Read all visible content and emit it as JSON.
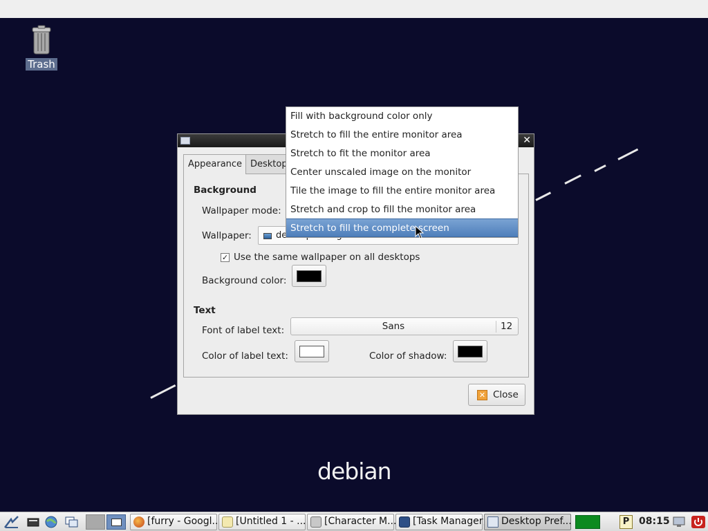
{
  "desktop": {
    "trash_label": "Trash",
    "logo_text": "debian",
    "background_color": "#0b0b2b"
  },
  "dialog": {
    "tabs": [
      {
        "label": "Appearance",
        "active": true
      },
      {
        "label": "Desktop",
        "active": false
      }
    ],
    "background": {
      "heading": "Background",
      "wallpaper_mode_label": "Wallpaper mode:",
      "wallpaper_label": "Wallpaper:",
      "wallpaper_value": "desktop-background",
      "same_wallpaper_label": "Use the same wallpaper on all desktops",
      "same_wallpaper_checked": true,
      "bg_color_label": "Background color:",
      "bg_color": "#000000"
    },
    "text": {
      "heading": "Text",
      "font_label": "Font of label text:",
      "font_name": "Sans",
      "font_size": "12",
      "label_color_label": "Color of label text:",
      "label_color": "#ffffff",
      "shadow_color_label": "Color of shadow:",
      "shadow_color": "#000000"
    },
    "close_label": "Close"
  },
  "wallpaper_mode_popup": {
    "options": [
      "Fill with background color only",
      "Stretch to fill the entire monitor area",
      "Stretch to fit the monitor area",
      "Center unscaled image on the monitor",
      "Tile the image to fill the entire monitor area",
      "Stretch and crop to fill the monitor area",
      "Stretch to fill the complete screen"
    ],
    "selected_index": 6
  },
  "taskbar": {
    "tasks": [
      {
        "label": "[furry - Googl...",
        "icon": "firefox-icon",
        "active": false
      },
      {
        "label": "[Untitled 1 - ...",
        "icon": "document-icon",
        "active": false
      },
      {
        "label": "[Character M...",
        "icon": "charmap-icon",
        "active": false
      },
      {
        "label": "[Task Manager]",
        "icon": "task-manager-icon",
        "active": false
      },
      {
        "label": "Desktop Pref...",
        "icon": "window-icon",
        "active": true
      }
    ],
    "clock": "08:15"
  }
}
